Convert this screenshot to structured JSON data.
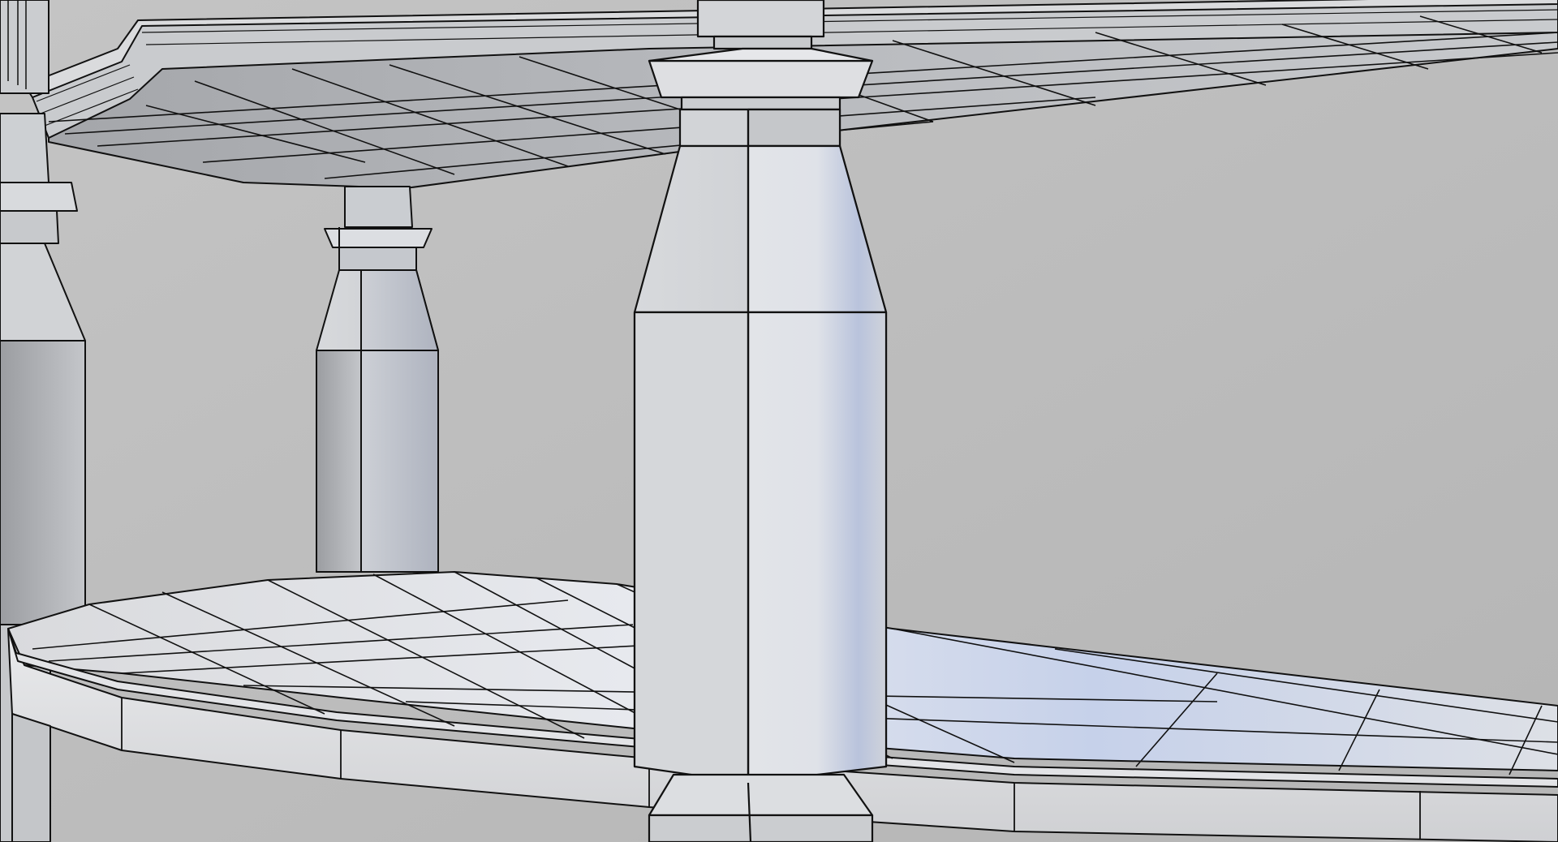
{
  "scene": {
    "subject": "wireframe-shaded-3d-shelf-model",
    "colors": {
      "background": "#bdbdbd",
      "surface_light": "#e6e8ec",
      "surface_mid": "#c8cacf",
      "surface_dark": "#8f9196",
      "highlight_blue": "#b9c8ea",
      "wire": "#111111"
    }
  }
}
